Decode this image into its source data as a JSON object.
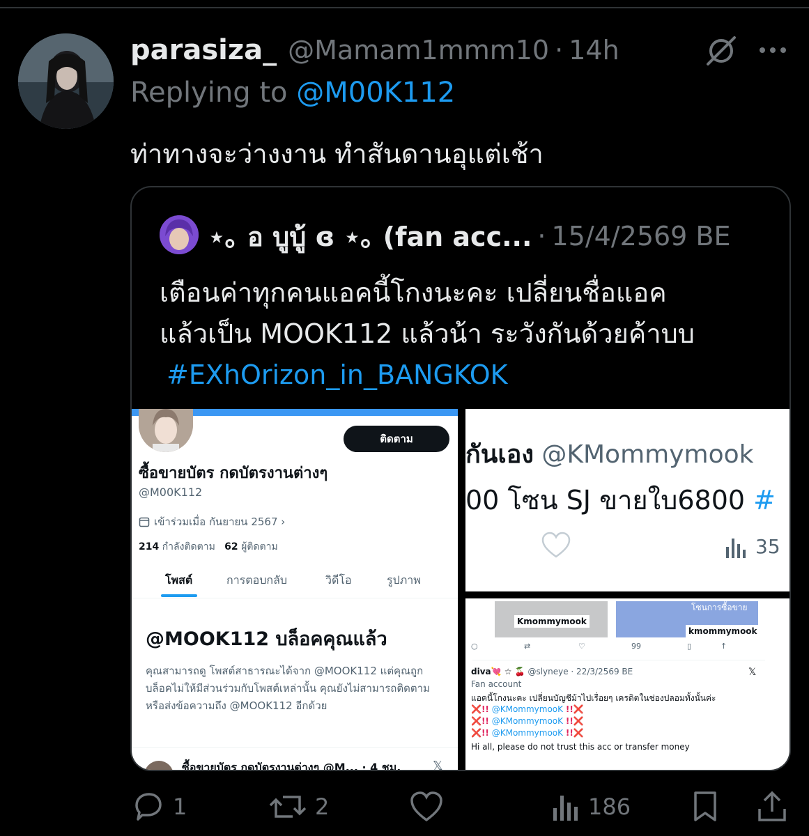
{
  "tweet": {
    "display_name": "parasiza_",
    "handle": "@Mamam1mmm10",
    "separator": "·",
    "time": "14h",
    "replying_label": "Replying to",
    "replying_to": "@M00K112",
    "text": "ท่าทางจะว่างงาน ทำสันดานอุแต่เช้า"
  },
  "quote": {
    "display_name": "⋆｡ อ บูบู้ ɞ ⋆｡ (fan acc...",
    "separator": "·",
    "date": "15/4/2569 BE",
    "text_line1": "เตือนค่าทุกคนแอคนี้โกงนะคะ เปลี่ยนชื่อแอค",
    "text_line2": "แล้วเป็น MOOK112 แล้วน้า ระวังกันด้วยค้าบบ",
    "hashtag": "#EXhOrizon_in_BANGKOK"
  },
  "image1": {
    "follow_button": "ติดตาม",
    "profile_name": "ซื้อขายบัตร กดบัตรงานต่างๆ",
    "profile_handle": "@M00K112",
    "joined": "เข้าร่วมเมื่อ กันยายน 2567 ›",
    "following_count": "214",
    "following_label": "กำลังติดตาม",
    "followers_count": "62",
    "followers_label": "ผู้ติดตาม",
    "tabs": [
      "โพสต์",
      "การตอบกลับ",
      "วิดีโอ",
      "รูปภาพ"
    ],
    "blocked_title": "@MOOK112 บล็อคคุณแล้ว",
    "blocked_desc": "คุณสามารถดู โพสต์สาธารณะได้จาก @MOOK112 แต่คุณถูกบล็อคไม่ให้มีส่วนร่วมกับโพสต์เหล่านั้น คุณยังไม่สามารถติดตามหรือส่งข้อความถึง @MOOK112 อีกด้วย",
    "bottom_text": "ซื้อขายบัตร กดบัตรงานต่างๆ @M... · 4 ชม.",
    "bottom_x": "𝕏"
  },
  "image2": {
    "line1_text": "กันเอง",
    "line1_handle": "@KMommymook",
    "line2_text": "00 โซน SJ ขายใบ6800",
    "line2_hash": "#",
    "views": "35"
  },
  "image3": {
    "card1_label": "Kmommymook",
    "card2_label": "kmommymook",
    "card2_top": "โซนการซื้อขาย",
    "views": "99",
    "author": "diva💘 ☆ 🍒",
    "author_handle": "@slyneye · 22/3/2569 BE",
    "fan_label": "Fan account",
    "text": "แอคนี้โกงนะคะ เปลี่ยนบัญชีม้าไปเรื่อยๆ เครดิตในช่องปลอมทั้งนั้นค่ะ",
    "warn_prefix": "❌!!",
    "warn_handle": "@KMommymooK",
    "warn_suffix": "!!❌",
    "english": "Hi all, please do not trust this acc or transfer money",
    "x": "𝕏"
  },
  "actions": {
    "replies": "1",
    "reposts": "2",
    "views": "186"
  }
}
